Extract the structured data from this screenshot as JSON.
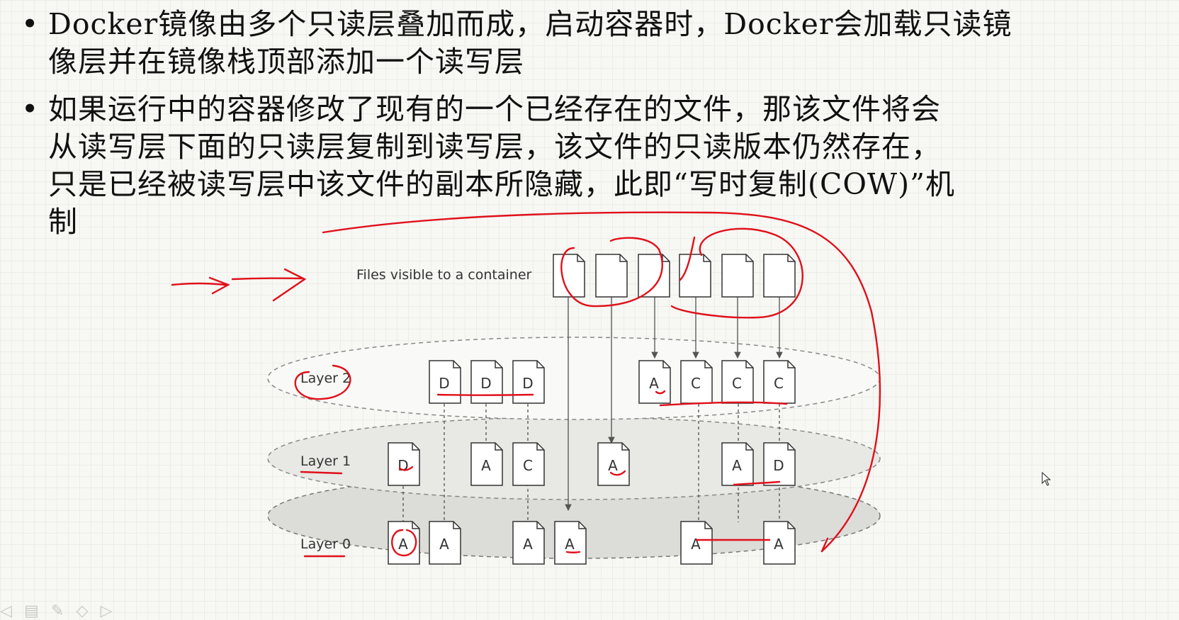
{
  "slide": {
    "bullets": [
      {
        "marker": "•",
        "text": "Docker镜像由多个只读层叠加而成，启动容器时，Docker会加载只读镜\n像层并在镜像栈顶部添加一个读写层"
      },
      {
        "marker": "•",
        "text": "如果运行中的容器修改了现有的一个已经存在的文件，那该文件将会\n从读写层下面的只读层复制到读写层，该文件的只读版本仍然存在，\n只是已经被读写层中该文件的副本所隐藏，此即“写时复制(COW)”机\n制"
      }
    ]
  },
  "diagram": {
    "container_label": "Files visible to a container",
    "layers": [
      {
        "label": "Layer 2",
        "files": [
          "D",
          "D",
          "D",
          "A",
          "C",
          "C",
          "C"
        ]
      },
      {
        "label": "Layer 1",
        "files": [
          "D",
          "A",
          "C",
          "A",
          "A",
          "D"
        ]
      },
      {
        "label": "Layer 0",
        "files": [
          "A",
          "A",
          "A",
          "A",
          "A",
          "A"
        ]
      }
    ],
    "colors": {
      "annotation": "#e0101a",
      "layer_fill": "#e6e6e3",
      "line": "#555555"
    }
  },
  "toolbar": {
    "icons": [
      "arrow-left-icon",
      "menu-icon",
      "pen-icon",
      "eraser-icon",
      "arrow-right-icon"
    ]
  }
}
